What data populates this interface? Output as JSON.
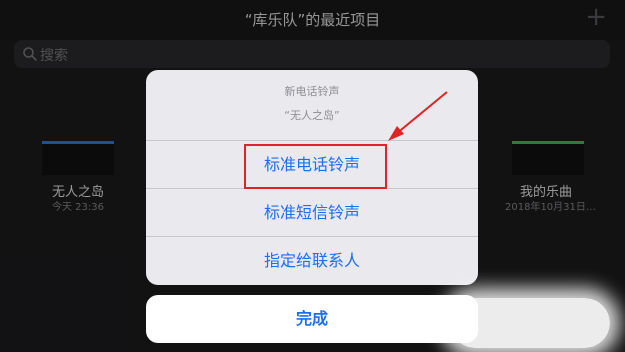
{
  "header": {
    "title": "“库乐队”的最近项目",
    "plus_icon": "plus-icon"
  },
  "search": {
    "placeholder": "搜索",
    "icon": "search-icon"
  },
  "files": [
    {
      "name": "无人之岛",
      "date": "今天 23:36"
    },
    {
      "name": "我的乐曲",
      "date": "2018年10月31日…"
    }
  ],
  "action_sheet": {
    "title": "新电话铃声",
    "subtitle": "“无人之岛”",
    "buttons": [
      {
        "label": "标准电话铃声"
      },
      {
        "label": "标准短信铃声"
      },
      {
        "label": "指定给联系人"
      }
    ],
    "done_label": "完成"
  },
  "colors": {
    "accent": "#1b6ff0",
    "highlight": "#e02424",
    "background": "#1c1c1e"
  }
}
